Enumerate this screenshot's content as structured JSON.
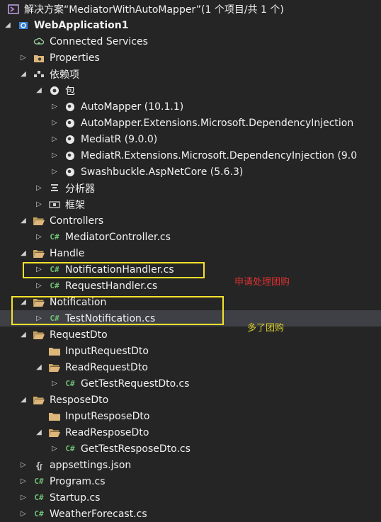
{
  "solution": {
    "label": "解决方案“MediatorWithAutoMapper”(1 个项目/共 1 个)"
  },
  "colors": {
    "background": "#252526",
    "selected_row": "#3f3f46",
    "folder": "#dcb67a",
    "csharp": "#6fbf73",
    "highlight_box": "#f5e22a",
    "note_red": "#e03030",
    "note_yellow": "#d8d02a"
  },
  "tree": [
    {
      "label": "WebApplication1",
      "level": 1,
      "expander": "open",
      "icon": "project-icon",
      "bold": true
    },
    {
      "label": "Connected Services",
      "level": 2,
      "expander": "none",
      "icon": "connected-services-icon"
    },
    {
      "label": "Properties",
      "level": 2,
      "expander": "closed",
      "icon": "properties-icon"
    },
    {
      "label": "依赖项",
      "level": 2,
      "expander": "open",
      "icon": "dependencies-icon"
    },
    {
      "label": "包",
      "level": 3,
      "expander": "open",
      "icon": "packages-icon"
    },
    {
      "label": "AutoMapper (10.1.1)",
      "level": 4,
      "expander": "closed",
      "icon": "package-icon"
    },
    {
      "label": "AutoMapper.Extensions.Microsoft.DependencyInjection",
      "level": 4,
      "expander": "closed",
      "icon": "package-icon"
    },
    {
      "label": "MediatR (9.0.0)",
      "level": 4,
      "expander": "closed",
      "icon": "package-icon"
    },
    {
      "label": "MediatR.Extensions.Microsoft.DependencyInjection (9.0",
      "level": 4,
      "expander": "closed",
      "icon": "package-icon"
    },
    {
      "label": "Swashbuckle.AspNetCore (5.6.3)",
      "level": 4,
      "expander": "closed",
      "icon": "package-icon"
    },
    {
      "label": "分析器",
      "level": 3,
      "expander": "closed",
      "icon": "analyzer-icon"
    },
    {
      "label": "框架",
      "level": 3,
      "expander": "closed",
      "icon": "framework-icon"
    },
    {
      "label": "Controllers",
      "level": 2,
      "expander": "open",
      "icon": "folder-open-icon"
    },
    {
      "label": "MediatorController.cs",
      "level": 3,
      "expander": "closed",
      "icon": "csharp-file-icon"
    },
    {
      "label": "Handle",
      "level": 2,
      "expander": "open",
      "icon": "folder-open-icon"
    },
    {
      "label": "NotificationHandler.cs",
      "level": 3,
      "expander": "closed",
      "icon": "csharp-file-icon"
    },
    {
      "label": "RequestHandler.cs",
      "level": 3,
      "expander": "closed",
      "icon": "csharp-file-icon"
    },
    {
      "label": "Notification",
      "level": 2,
      "expander": "open",
      "icon": "folder-open-icon"
    },
    {
      "label": "TestNotification.cs",
      "level": 3,
      "expander": "closed",
      "icon": "csharp-file-icon",
      "selected": true
    },
    {
      "label": "RequestDto",
      "level": 2,
      "expander": "open",
      "icon": "folder-open-icon"
    },
    {
      "label": "InputRequestDto",
      "level": 3,
      "expander": "none",
      "icon": "folder-icon"
    },
    {
      "label": "ReadRequestDto",
      "level": 3,
      "expander": "open",
      "icon": "folder-open-icon"
    },
    {
      "label": "GetTestRequestDto.cs",
      "level": 4,
      "expander": "closed",
      "icon": "csharp-file-icon"
    },
    {
      "label": "ResposeDto",
      "level": 2,
      "expander": "open",
      "icon": "folder-open-icon"
    },
    {
      "label": "InputResposeDto",
      "level": 3,
      "expander": "none",
      "icon": "folder-icon"
    },
    {
      "label": "ReadResposeDto",
      "level": 3,
      "expander": "open",
      "icon": "folder-open-icon"
    },
    {
      "label": "GetTestResposeDto.cs",
      "level": 4,
      "expander": "closed",
      "icon": "csharp-file-icon"
    },
    {
      "label": "appsettings.json",
      "level": 2,
      "expander": "closed",
      "icon": "json-file-icon"
    },
    {
      "label": "Program.cs",
      "level": 2,
      "expander": "closed",
      "icon": "csharp-file-icon"
    },
    {
      "label": "Startup.cs",
      "level": 2,
      "expander": "closed",
      "icon": "csharp-file-icon"
    },
    {
      "label": "WeatherForecast.cs",
      "level": 2,
      "expander": "closed",
      "icon": "csharp-file-icon"
    }
  ],
  "annotations": {
    "note1": "申请处理团购",
    "note2": "多了团购"
  }
}
